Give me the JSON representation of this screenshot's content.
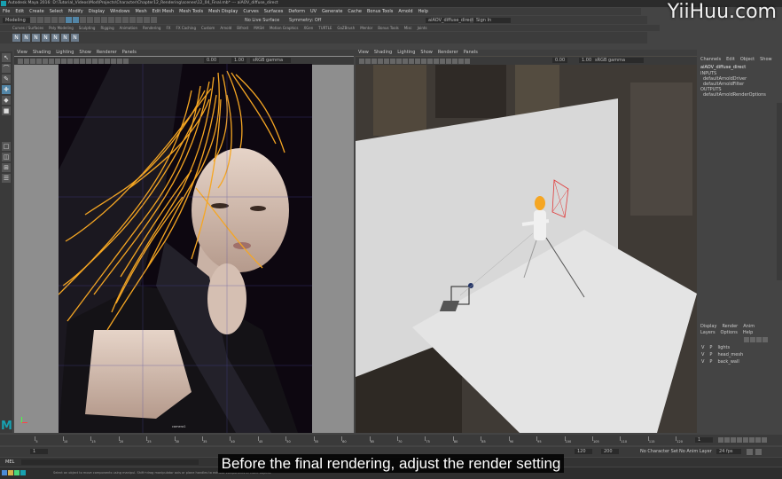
{
  "app_title": "Autodesk Maya 2016: D:\\Tutorial_Videos\\Mod\\Projects\\Character\\Chapter12_Rendering\\scenes\\12_04_Final.mb* --- aiAOV_diffuse_direct",
  "watermark": "YiiHuu.com",
  "menubar": [
    "File",
    "Edit",
    "Create",
    "Select",
    "Modify",
    "Display",
    "Windows",
    "Mesh",
    "Edit Mesh",
    "Mesh Tools",
    "Mesh Display",
    "Curves",
    "Surfaces",
    "Deform",
    "UV",
    "Generate",
    "Cache",
    "Bonus Tools",
    "Arnold",
    "Help"
  ],
  "status_line": {
    "mode": "Modeling",
    "no_live_surface": "No Live Surface",
    "symmetry": "Symmetry: Off",
    "search_field": "aiAOV_diffuse_direct",
    "sign_in": "Sign In"
  },
  "shelf_tabs": [
    "Curves / Surfaces",
    "Poly Modeling",
    "Sculpting",
    "Rigging",
    "Animation",
    "Rendering",
    "FX",
    "FX Caching",
    "Custom",
    "Arnold",
    "Bifrost",
    "MASH",
    "Motion Graphics",
    "XGen",
    "TURTLE",
    "GoZBrush",
    "Mentor",
    "Bonus Tools",
    "Misc",
    "Joints"
  ],
  "shelf_icons": [
    "N",
    "N",
    "N",
    "N",
    "N",
    "N",
    "N"
  ],
  "left_viewport": {
    "menu": [
      "View",
      "Shading",
      "Lighting",
      "Show",
      "Renderer",
      "Panels"
    ],
    "val_a": "0.00",
    "val_b": "1.00",
    "color_space": "sRGB gamma",
    "camera_label": "camera1"
  },
  "right_viewport": {
    "menu": [
      "View",
      "Shading",
      "Lighting",
      "Show",
      "Renderer",
      "Panels"
    ],
    "val_a": "0.00",
    "val_b": "1.00",
    "color_space": "sRGB gamma"
  },
  "channel_box": {
    "menu": [
      "Channels",
      "Edit",
      "Object",
      "Show"
    ],
    "node": "aiAOV_diffuse_direct",
    "inputs_label": "INPUTS",
    "inputs": [
      "defaultArnoldDriver",
      "defaultArnoldFilter"
    ],
    "outputs_label": "OUTPUTS",
    "outputs": [
      "defaultArnoldRenderOptions"
    ]
  },
  "layer_editor": {
    "tabs": [
      "Display",
      "Render",
      "Anim"
    ],
    "menu": [
      "Layers",
      "Options",
      "Help"
    ],
    "layers": [
      {
        "v": "V",
        "p": "P",
        "name": "lights"
      },
      {
        "v": "V",
        "p": "P",
        "name": "head_mesh"
      },
      {
        "v": "V",
        "p": "P",
        "name": "back_wall"
      }
    ]
  },
  "timeline": {
    "frame_current": "1",
    "range_start": "1",
    "range_end": "120",
    "anim_end": "200",
    "no_character_set": "No Character Set",
    "no_anim_layer": "No Anim Layer",
    "fps": "24 fps",
    "tick_labels": [
      "5",
      "10",
      "15",
      "20",
      "25",
      "30",
      "35",
      "40",
      "45",
      "50",
      "55",
      "60",
      "65",
      "70",
      "75",
      "80",
      "85",
      "90",
      "95",
      "100",
      "105",
      "110",
      "115",
      "120"
    ]
  },
  "command_line": {
    "label": "MEL",
    "help_text": "Select an object to move components using manipul. Shift+drag manipulator axis or plane handles to extrude components or clone objects."
  },
  "subtitle": "Before the final rendering, adjust the render setting",
  "colors": {
    "hair": "#f5a623",
    "accent_blue": "#5285a6",
    "wall": "#d8d8d8"
  }
}
